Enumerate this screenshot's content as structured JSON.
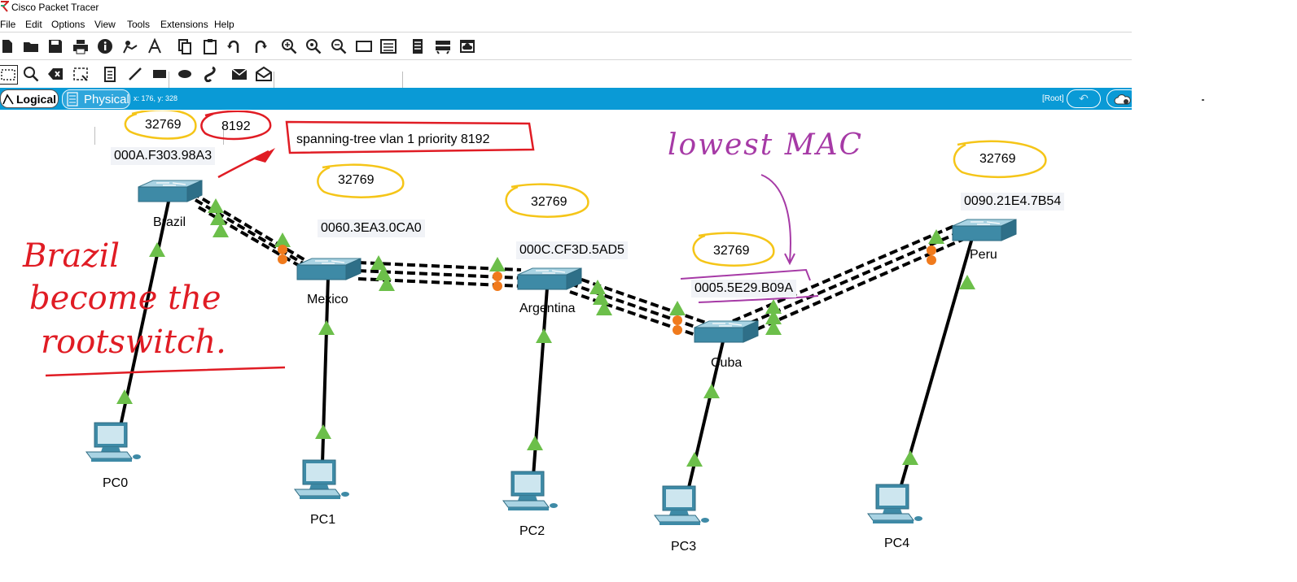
{
  "window": {
    "title": "Cisco Packet Tracer"
  },
  "menu": [
    "File",
    "Edit",
    "Options",
    "View",
    "Tools",
    "Extensions",
    "Help"
  ],
  "workspace": {
    "tab_logical": "Logical",
    "tab_physical": "Physical",
    "coords": "x: 176, y: 328",
    "root_label": "[Root]"
  },
  "switches": [
    {
      "name": "Brazil",
      "mac": "000A.F303.98A3",
      "priority": "32769"
    },
    {
      "name": "Mexico",
      "mac": "0060.3EA3.0CA0",
      "priority": "32769"
    },
    {
      "name": "Argentina",
      "mac": "000C.CF3D.5AD5",
      "priority": "32769"
    },
    {
      "name": "Cuba",
      "mac": "0005.5E29.B09A",
      "priority": "32769"
    },
    {
      "name": "Peru",
      "mac": "0090.21E4.7B54",
      "priority": "32769"
    }
  ],
  "pcs": [
    "PC0",
    "PC1",
    "PC2",
    "PC3",
    "PC4"
  ],
  "annotations": {
    "new_priority": "8192",
    "command": "spanning-tree vlan 1 priority 8192",
    "lowest_mac": "lowest MAC",
    "root_note_1": "Brazil",
    "root_note_2": "become the",
    "root_note_3": "rootswitch."
  },
  "colors": {
    "accent_bar": "#0a9ad6",
    "link_up": "#6cbf4a",
    "link_blocked": "#f07a1c",
    "ann_yellow": "#f5c518",
    "ann_red": "#e01c24",
    "ann_purple": "#a63aa6"
  }
}
